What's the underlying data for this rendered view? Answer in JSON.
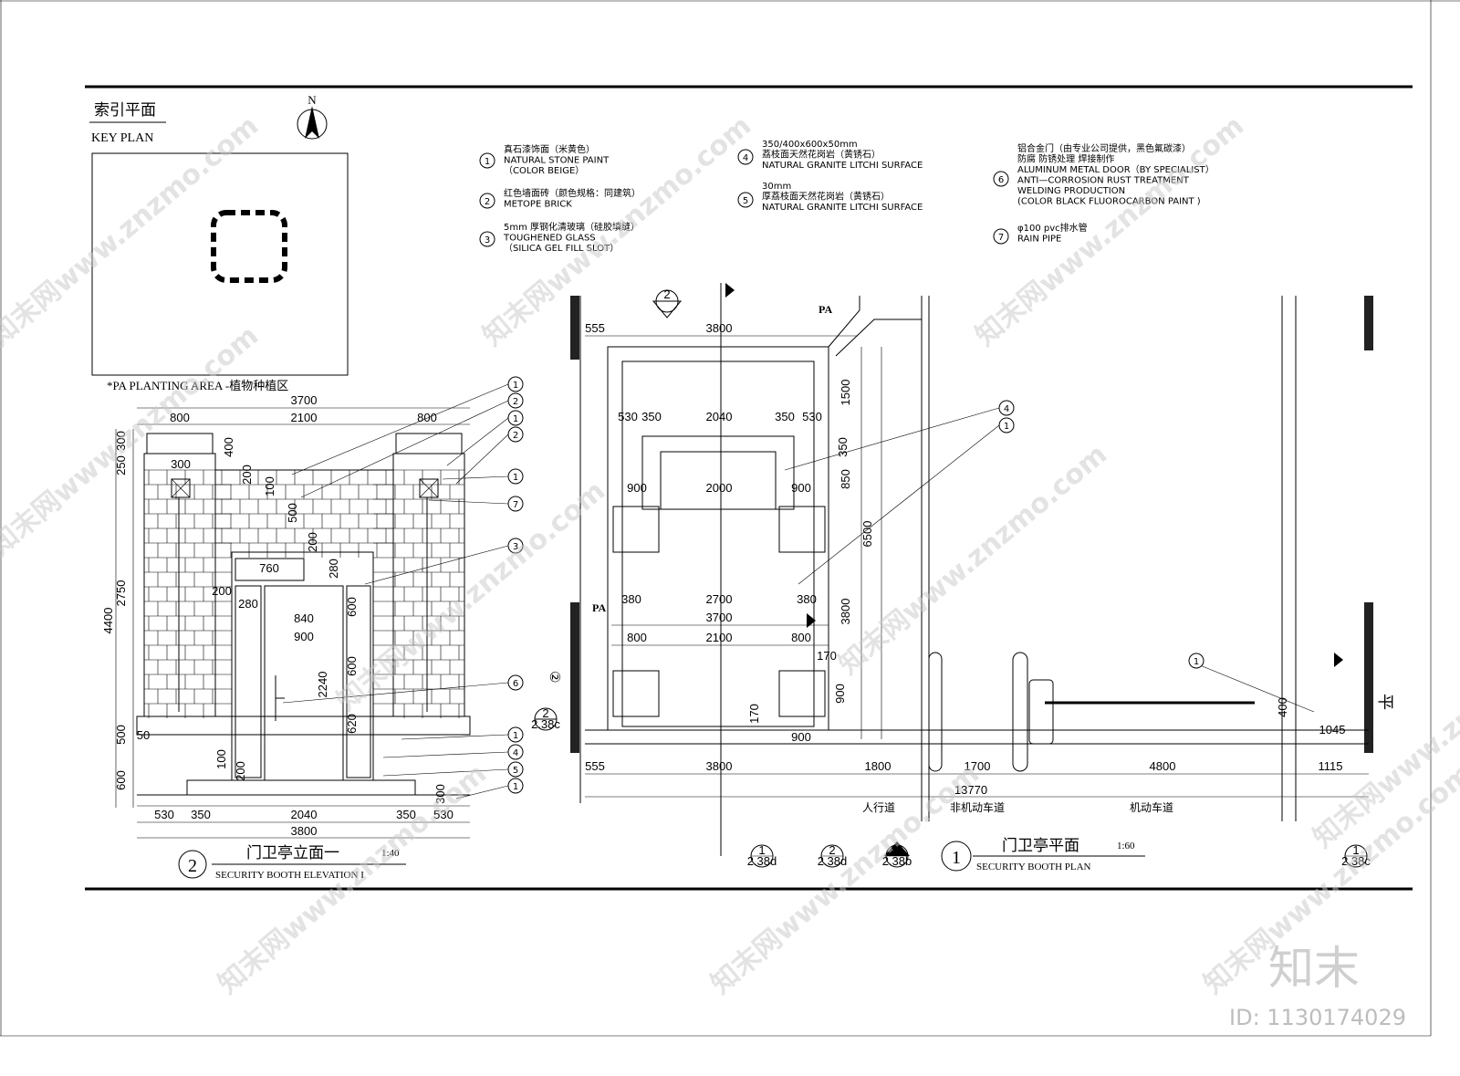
{
  "key_plan": {
    "title_cn": "索引平面",
    "title_en": "KEY PLAN",
    "north": "N",
    "pa_note": "*PA    PLANTING AREA -植物种植区"
  },
  "legend": [
    {
      "num": "1",
      "lines": [
        "真石漆饰面（米黄色）",
        "NATURAL STONE PAINT",
        "（COLOR BEIGE）"
      ]
    },
    {
      "num": "2",
      "lines": [
        "红色墙面砖（颜色规格：同建筑）",
        "METOPE BRICK"
      ]
    },
    {
      "num": "3",
      "lines": [
        "5mm 厚钢化清玻璃（硅胶填缝）",
        "TOUGHENED GLASS",
        "（SILICA GEL FILL SLOT）"
      ]
    },
    {
      "num": "4",
      "lines": [
        "350/400x600x50mm",
        "荔枝面天然花岗岩（黄锈石）",
        "NATURAL GRANITE LITCHI SURFACE"
      ]
    },
    {
      "num": "5",
      "lines": [
        "30mm",
        "厚荔枝面天然花岗岩（黄锈石）",
        "NATURAL GRANITE LITCHI SURFACE"
      ]
    },
    {
      "num": "6",
      "lines": [
        "铝合金门（由专业公司提供，黑色氟碳漆）",
        "防腐 防锈处理 焊接制作",
        "ALUMINUM METAL DOOR（BY SPECIALIST）",
        "ANTI—CORROSION RUST TREATMENT",
        "WELDING PRODUCTION",
        "(COLOR BLACK FLUOROCARBON PAINT )"
      ]
    },
    {
      "num": "7",
      "lines": [
        "φ100 pvc排水管",
        "RAIN PIPE"
      ]
    }
  ],
  "elevation": {
    "title_num": "2",
    "title_cn": "门卫亭立面一",
    "scale": "1:40",
    "title_en": "SECURITY BOOTH ELEVATION I",
    "dims": [
      "3700",
      "800",
      "2100",
      "800",
      "300",
      "250",
      "2750",
      "4400",
      "500",
      "600",
      "530",
      "350",
      "2040",
      "350",
      "530",
      "3800",
      "300",
      "400",
      "200",
      "100",
      "500",
      "200",
      "760",
      "280",
      "200",
      "280",
      "840",
      "900",
      "600",
      "2240",
      "600",
      "620",
      "50",
      "100",
      "200",
      "300"
    ],
    "callouts": [
      "1",
      "2",
      "1",
      "2",
      "1",
      "7",
      "3",
      "6",
      "1",
      "4",
      "5",
      "1"
    ],
    "section_ref": {
      "num": "2",
      "sheet": "2.38c"
    }
  },
  "plan": {
    "title_num": "1",
    "title_cn": "门卫亭平面",
    "scale": "1:60",
    "title_en": "SECURITY BOOTH PLAN",
    "pa_labels": [
      "PA",
      "PA"
    ],
    "dims": [
      "555",
      "3800",
      "530",
      "350",
      "2040",
      "350",
      "530",
      "900",
      "2000",
      "900",
      "380",
      "2700",
      "380",
      "3700",
      "800",
      "2100",
      "800",
      "170",
      "900",
      "170",
      "900",
      "1500",
      "350",
      "850",
      "6500",
      "3800",
      "555",
      "3800",
      "1800",
      "1700",
      "4800",
      "1115",
      "13770",
      "1045",
      "400"
    ],
    "zones": [
      "人行道",
      "非机动车道",
      "机动车道"
    ],
    "callouts": [
      "4",
      "1",
      "1"
    ],
    "section_marker_top": "2",
    "section_refs": [
      {
        "num": "1",
        "sheet": "2.38d"
      },
      {
        "num": "2",
        "sheet": "2.38d"
      },
      {
        "num": "",
        "sheet": "2.38b"
      },
      {
        "num": "1",
        "sheet": "2.38c"
      }
    ],
    "rotated_label": "②",
    "rotated_label_right": "平"
  },
  "watermark": {
    "logo": "知末",
    "id": "ID: 1130174029",
    "repeat_text": "知末网www.znzmo.com"
  }
}
